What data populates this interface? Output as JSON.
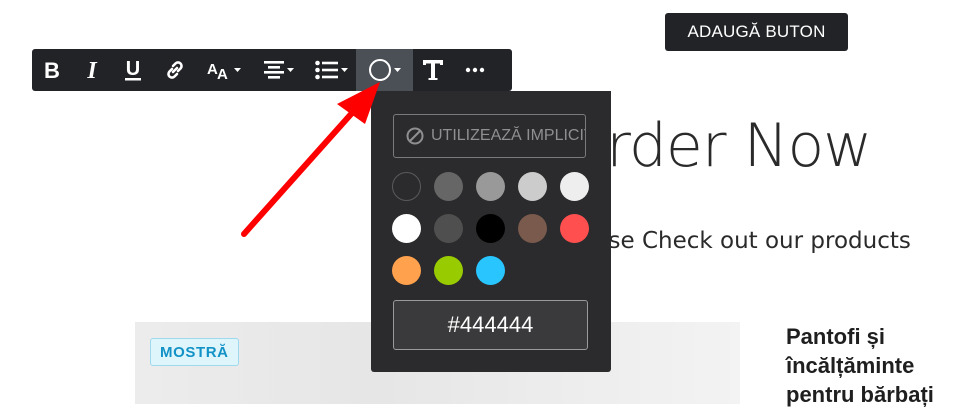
{
  "page": {
    "add_button_label": "ADAUGĂ BUTON",
    "hero_title": "Order Now",
    "hero_subtitle": "Please Check out our products",
    "product_title": "Pantofi și încălțăminte pentru bărbați",
    "sample_badge": "MOSTRĂ"
  },
  "toolbar": {
    "buttons": [
      {
        "name": "bold",
        "icon": "bold-icon"
      },
      {
        "name": "italic",
        "icon": "italic-icon"
      },
      {
        "name": "underline",
        "icon": "underline-icon"
      },
      {
        "name": "link",
        "icon": "link-icon"
      },
      {
        "name": "font-size",
        "icon": "font-size-icon"
      },
      {
        "name": "align",
        "icon": "align-center-icon"
      },
      {
        "name": "list",
        "icon": "bulleted-list-icon"
      },
      {
        "name": "text-color",
        "icon": "color-circle-icon",
        "active": true
      },
      {
        "name": "text-style",
        "icon": "text-icon"
      },
      {
        "name": "more",
        "icon": "more-icon"
      }
    ]
  },
  "color_panel": {
    "default_label": "UTILIZEAZĂ IMPLICIT",
    "swatches": [
      "#2b2b2d",
      "#666666",
      "#999999",
      "#cccccc",
      "#eeeeee",
      "#ffffff",
      "#4f4f4f",
      "#000000",
      "#7a5a4c",
      "#ff4f4f",
      "#ffa14d",
      "#99cc00",
      "#29c5ff"
    ],
    "hex_value": "#444444"
  },
  "colors": {
    "toolbar_bg": "#222326",
    "panel_bg": "#2b2b2d",
    "annotation_arrow": "#ff0000"
  }
}
